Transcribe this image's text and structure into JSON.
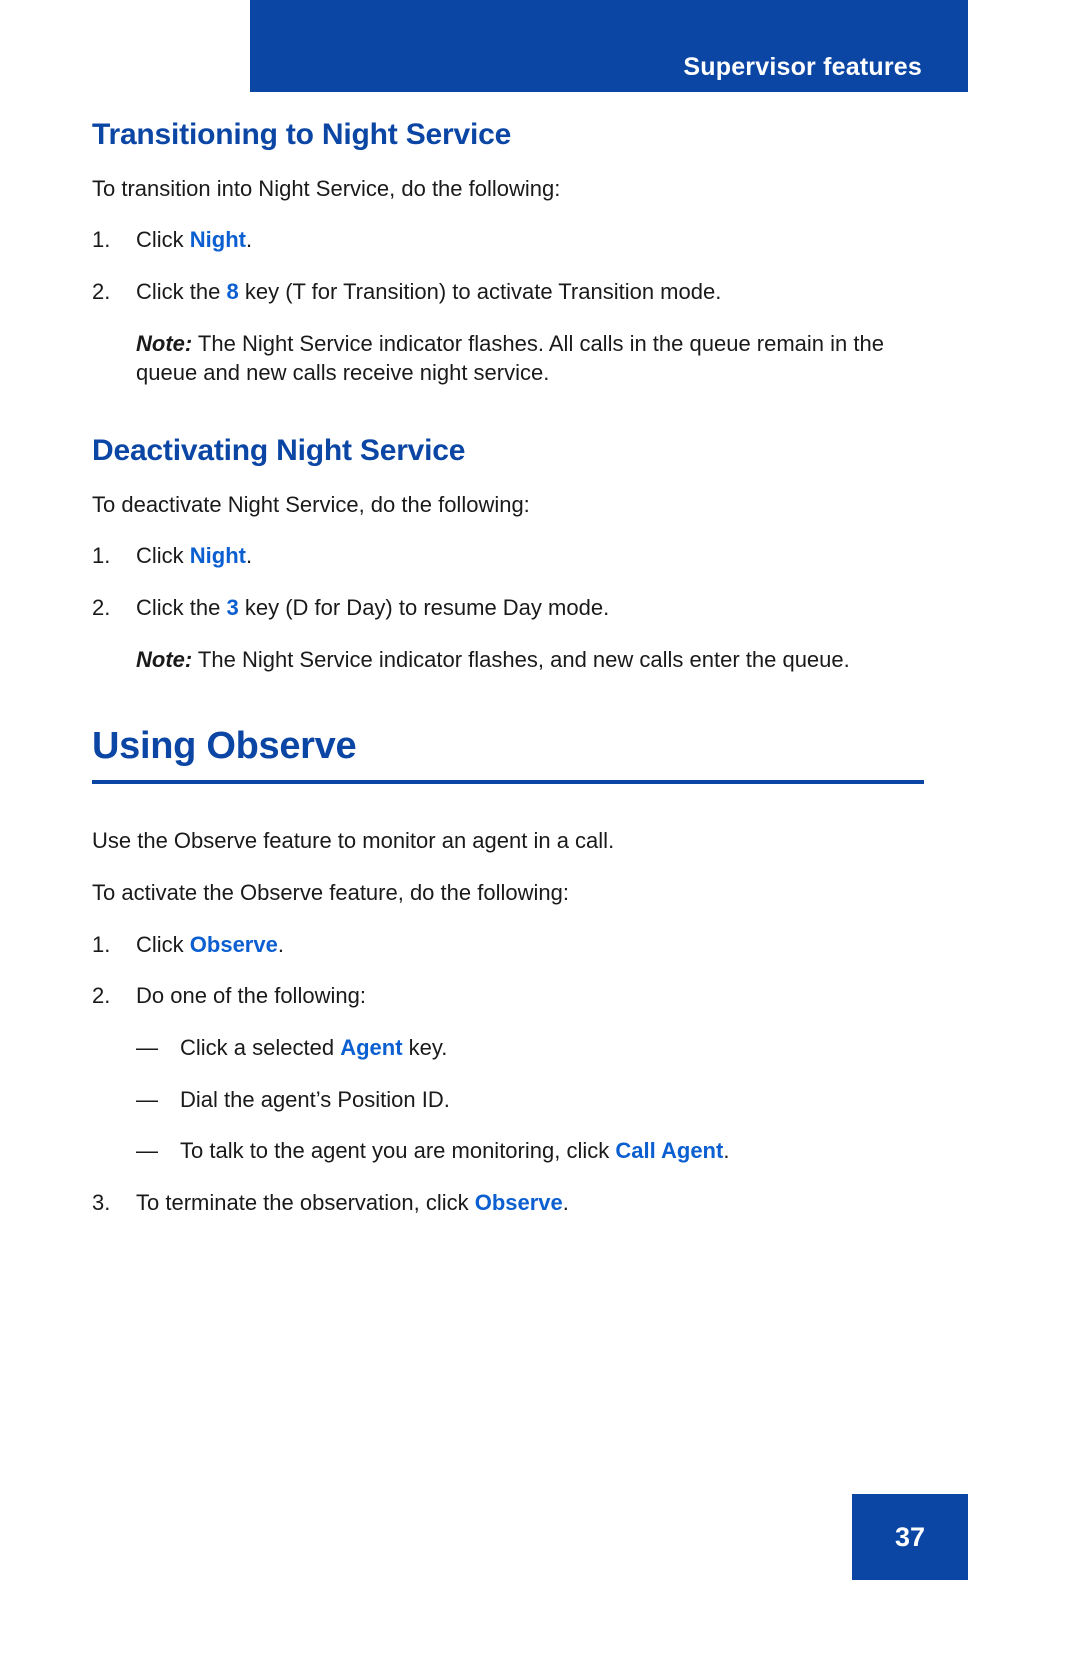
{
  "header": {
    "title": "Supervisor features"
  },
  "sections": [
    {
      "heading": "Transitioning to Night Service",
      "intro": "To transition into Night Service, do the following:",
      "steps": [
        {
          "marker": "1.",
          "pre": "Click ",
          "emphasis": "Night",
          "post": "."
        },
        {
          "marker": "2.",
          "pre": "Click the ",
          "emphasis": "8",
          "post": " key (T for Transition) to activate Transition mode."
        }
      ],
      "note": {
        "label": "Note:",
        "text": " The Night Service indicator flashes. All calls in the queue remain in the queue and new calls receive night service."
      }
    },
    {
      "heading": "Deactivating Night Service",
      "intro": "To deactivate Night Service, do the following:",
      "steps": [
        {
          "marker": "1.",
          "pre": "Click ",
          "emphasis": "Night",
          "post": "."
        },
        {
          "marker": "2.",
          "pre": "Click the ",
          "emphasis": "3",
          "post": " key (D for Day) to resume Day mode."
        }
      ],
      "note": {
        "label": "Note:",
        "text": " The Night Service indicator flashes, and new calls enter the queue."
      }
    }
  ],
  "major_section": {
    "heading": "Using Observe",
    "intro_1": "Use the Observe feature to monitor an agent in a call.",
    "intro_2": "To activate the Observe feature, do the following:",
    "steps": [
      {
        "marker": "1.",
        "pre": "Click ",
        "emphasis": "Observe",
        "post": "."
      },
      {
        "marker": "2.",
        "pre": "Do one of the following:",
        "emphasis": "",
        "post": ""
      },
      {
        "marker": "3.",
        "pre": "To terminate the observation, click ",
        "emphasis": "Observe",
        "post": "."
      }
    ],
    "sub_items": [
      {
        "marker": "—",
        "pre": "Click a selected ",
        "emphasis": "Agent",
        "post": " key."
      },
      {
        "marker": "—",
        "pre": "Dial the agent’s Position ID.",
        "emphasis": "",
        "post": ""
      },
      {
        "marker": "—",
        "pre": "To talk to the agent you are monitoring, click ",
        "emphasis": "Call Agent",
        "post": "."
      }
    ]
  },
  "footer": {
    "page_number": "37"
  },
  "colors": {
    "brand_blue": "#0b46a5",
    "link_blue": "#0b5fd0",
    "body_black": "#1a1a1a"
  }
}
